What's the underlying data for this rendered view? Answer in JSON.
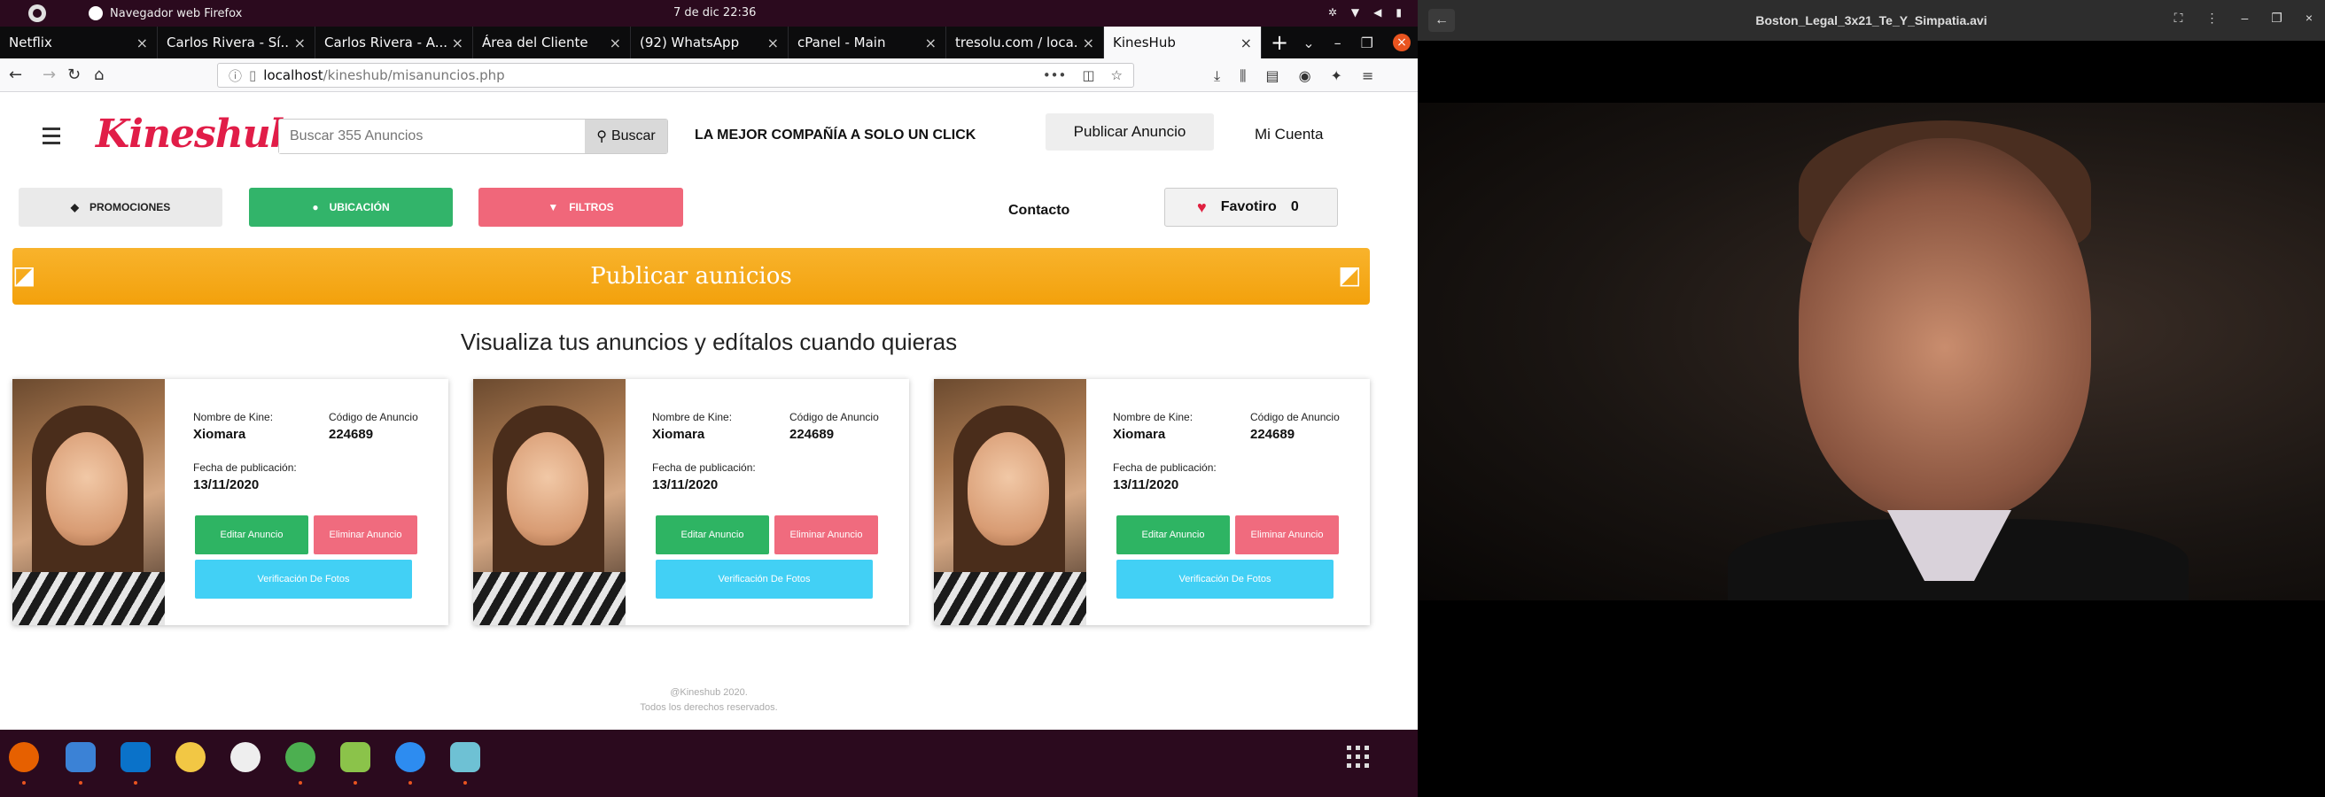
{
  "system": {
    "app_name": "Navegador web Firefox",
    "clock": "7 de dic  22:36"
  },
  "browser": {
    "tabs": [
      {
        "label": "Netflix",
        "color": "#e50914"
      },
      {
        "label": "Carlos Rivera - Sí...",
        "color": "#ff0000"
      },
      {
        "label": "Carlos Rivera - A...",
        "color": "#ff0000"
      },
      {
        "label": "Área del Cliente",
        "color": "#6b3fa0"
      },
      {
        "label": "(92) WhatsApp",
        "color": "#25d366"
      },
      {
        "label": "cPanel - Main",
        "color": "#ff6c2c"
      },
      {
        "label": "tresolu.com / loca...",
        "color": "#f29111"
      },
      {
        "label": "KinesHub",
        "color": "#f9f9fa"
      }
    ],
    "url_host": "localhost",
    "url_path": "/kineshub/misanuncios.php"
  },
  "site": {
    "logo": "Kineshub",
    "search_placeholder": "Buscar 355 Anuncios",
    "search_button": "Buscar",
    "tagline": "LA MEJOR COMPAÑÍA A SOLO UN CLICK",
    "publish_button": "Publicar Anuncio",
    "account": "Mi Cuenta",
    "promos": "PROMOCIONES",
    "location": "UBICACIÓN",
    "filters": "FILTROS",
    "contact": "Contacto",
    "favorites_label": "Favotiro",
    "favorites_count": "0",
    "banner": "Publicar aunicios",
    "subtitle": "Visualiza tus anuncios y edítalos cuando quieras",
    "footer_line1": "@Kineshub 2020.",
    "footer_line2": "Todos los derechos reservados.",
    "colors": {
      "brand": "#e11d48",
      "green": "#32b46a",
      "pink": "#f0677a",
      "cyan": "#42d0f5",
      "banner": "#f4a614"
    }
  },
  "cards": [
    {
      "name_label": "Nombre de Kine:",
      "name": "Xiomara",
      "code_label": "Código de Anuncio",
      "code": "224689",
      "date_label": "Fecha de publicación:",
      "date": "13/11/2020",
      "edit": "Editar Anuncio",
      "delete": "Eliminar Anuncio",
      "verify": "Verificación De Fotos"
    },
    {
      "name_label": "Nombre de Kine:",
      "name": "Xiomara",
      "code_label": "Código de Anuncio",
      "code": "224689",
      "date_label": "Fecha de publicación:",
      "date": "13/11/2020",
      "edit": "Editar Anuncio",
      "delete": "Eliminar Anuncio",
      "verify": "Verificación De Fotos"
    },
    {
      "name_label": "Nombre de Kine:",
      "name": "Xiomara",
      "code_label": "Código de Anuncio",
      "code": "224689",
      "date_label": "Fecha de publicación:",
      "date": "13/11/2020",
      "edit": "Editar Anuncio",
      "delete": "Eliminar Anuncio",
      "verify": "Verificación De Fotos"
    }
  ],
  "player": {
    "title": "Boston_Legal_3x21_Te_Y_Simpatia.avi"
  }
}
